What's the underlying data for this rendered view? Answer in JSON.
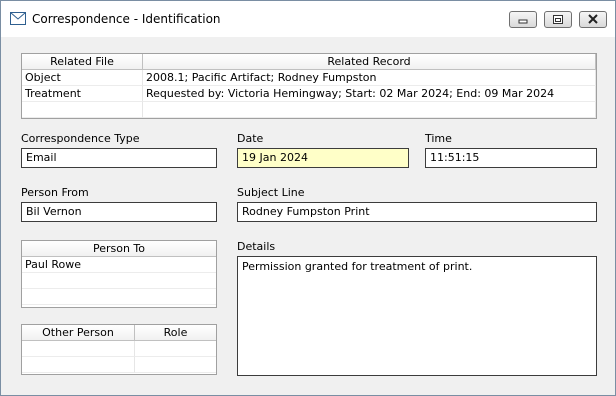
{
  "window": {
    "title": "Correspondence - Identification"
  },
  "related_grid": {
    "headers": [
      "Related File",
      "Related Record"
    ],
    "rows": [
      [
        "Object",
        "2008.1; Pacific Artifact; Rodney Fumpston"
      ],
      [
        "Treatment",
        "Requested by: Victoria Hemingway; Start: 02 Mar 2024; End: 09 Mar 2024"
      ]
    ]
  },
  "form": {
    "correspondence_type_label": "Correspondence Type",
    "correspondence_type_value": "Email",
    "date_label": "Date",
    "date_value": "19 Jan 2024",
    "time_label": "Time",
    "time_value": "11:51:15",
    "person_from_label": "Person From",
    "person_from_value": "Bil Vernon",
    "subject_label": "Subject Line",
    "subject_value": "Rodney Fumpston Print",
    "details_label": "Details",
    "details_value": "Permission granted for treatment of print."
  },
  "person_to_grid": {
    "header": "Person To",
    "rows": [
      "Paul Rowe"
    ]
  },
  "other_person_grid": {
    "headers": [
      "Other Person",
      "Role"
    ]
  },
  "icons": {
    "title": "envelope-icon",
    "minimize": "minimize-icon",
    "restore": "restore-icon",
    "close": "close-icon"
  }
}
